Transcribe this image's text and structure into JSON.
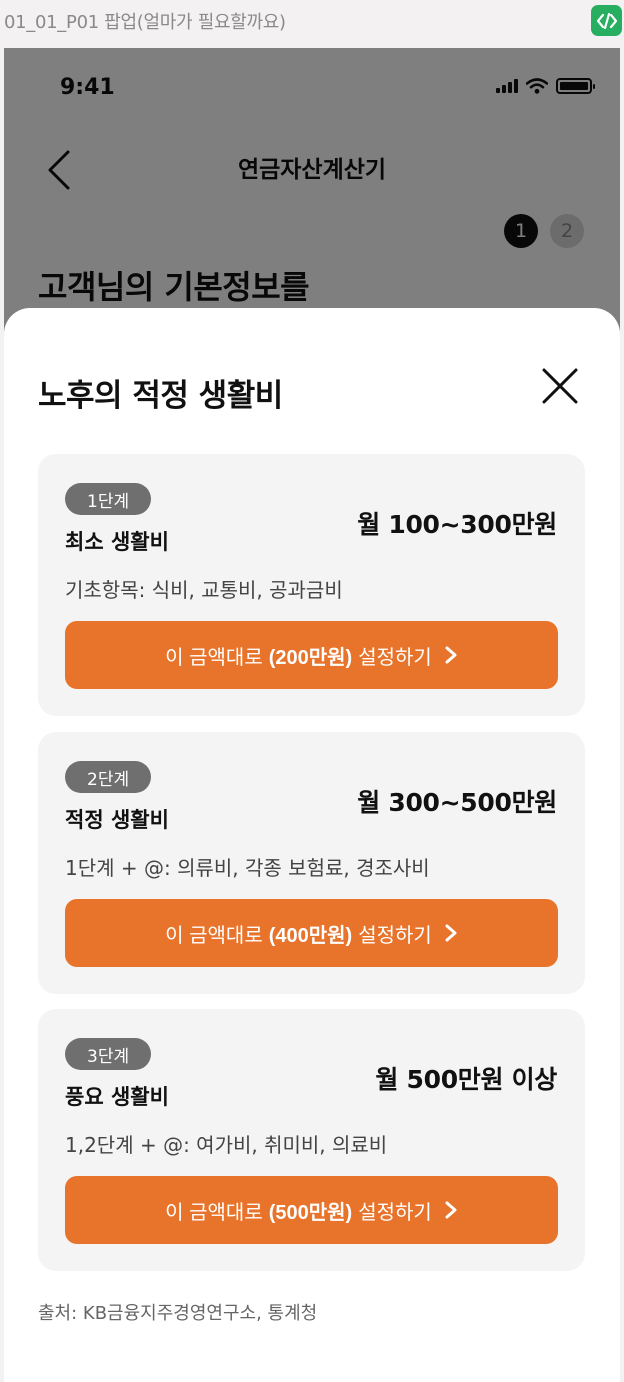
{
  "frame": {
    "label": "01_01_P01 팝업(얼마가 필요할까요)",
    "code_icon": "code-icon"
  },
  "status_bar": {
    "time": "9:41",
    "icons": [
      "cellular-signal-icon",
      "wifi-icon",
      "battery-icon"
    ]
  },
  "background_screen": {
    "nav_title": "연금자산계산기",
    "steps": [
      "1",
      "2"
    ],
    "active_step": "1",
    "heading": "고객님의 기본정보를"
  },
  "sheet": {
    "title": "노후의 적정 생활비",
    "close_icon": "close-icon",
    "cards": [
      {
        "badge": "1단계",
        "name": "최소 생활비",
        "amount": "월 100~300만원",
        "desc": "기초항목: 식비, 교통비, 공과금비",
        "cta": {
          "prefix": "이 금액대로",
          "amount": "(200만원)",
          "suffix": "설정하기"
        }
      },
      {
        "badge": "2단계",
        "name": "적정 생활비",
        "amount": "월 300~500만원",
        "desc": "1단계 + @: 의류비, 각종 보험료, 경조사비",
        "cta": {
          "prefix": "이 금액대로",
          "amount": "(400만원)",
          "suffix": "설정하기"
        }
      },
      {
        "badge": "3단계",
        "name": "풍요 생활비",
        "amount": "월 500만원 이상",
        "desc": "1,2단계 + @: 여가비, 취미비, 의료비",
        "cta": {
          "prefix": "이 금액대로",
          "amount": "(500만원)",
          "suffix": "설정하기"
        }
      }
    ],
    "source": "출처: KB금융지주경영연구소, 통계청"
  },
  "colors": {
    "accent": "#e8732a",
    "badge": "#6f6f6f",
    "card_bg": "#f4f4f5",
    "code_icon": "#27ae60"
  }
}
